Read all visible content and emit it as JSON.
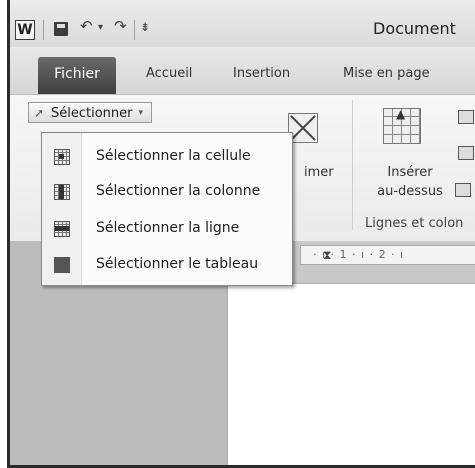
{
  "window": {
    "title": "Document"
  },
  "quick_access": {
    "app_icon": "W",
    "undo_glyph": "↶",
    "redo_glyph": "↷",
    "dropdown_glyph": "▾",
    "customize_glyph": "⇟"
  },
  "tabs": [
    {
      "label": "Fichier"
    },
    {
      "label": "Accueil"
    },
    {
      "label": "Insertion"
    },
    {
      "label": "Mise en page"
    }
  ],
  "ribbon": {
    "select_button": {
      "label": "Sélectionner",
      "arrow": "▾"
    },
    "delete_partial_label": "imer",
    "insert_above": {
      "line1": "Insérer",
      "line2": "au-dessus"
    },
    "group_label": "Lignes et colon"
  },
  "menu": {
    "items": [
      {
        "label": "Sélectionner la cellule",
        "icon": "select-cell-icon"
      },
      {
        "label": "Sélectionner la colonne",
        "icon": "select-column-icon"
      },
      {
        "label": "Sélectionner la ligne",
        "icon": "select-row-icon"
      },
      {
        "label": "Sélectionner le tableau",
        "icon": "select-table-icon"
      }
    ]
  },
  "ruler": {
    "text": "· ı · 1 · ı · 2 · ı"
  },
  "colors": {
    "file_tab": "#4f4f4f",
    "menu_bg": "#fbfbfb",
    "ribbon_bg": "#f3f3f3"
  }
}
